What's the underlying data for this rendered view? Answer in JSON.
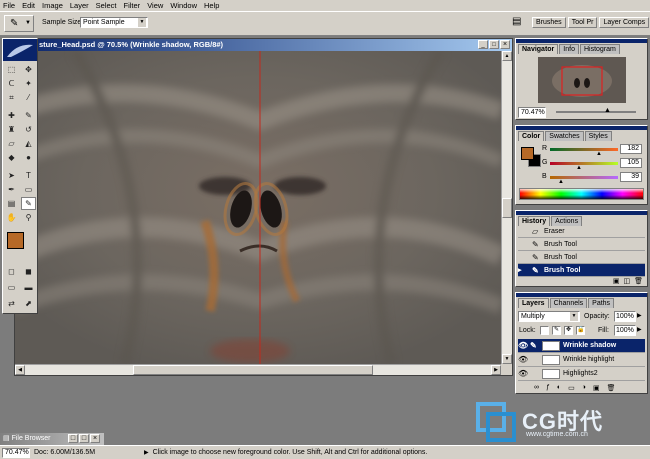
{
  "menu": [
    "File",
    "Edit",
    "Image",
    "Layer",
    "Select",
    "Filter",
    "View",
    "Window",
    "Help"
  ],
  "options": {
    "sample_size_label": "Sample Size:",
    "sample_size_value": "Point Sample"
  },
  "wells": [
    "Brushes",
    "Tool Pr",
    "Layer Comps"
  ],
  "document": {
    "title": "sture_Head.psd @ 70.5% (Wrinkle shadow, RGB/8#)"
  },
  "navigator": {
    "tabs": [
      "Navigator",
      "Info",
      "Histogram"
    ],
    "zoom": "70.47%"
  },
  "color": {
    "tabs": [
      "Color",
      "Swatches",
      "Styles"
    ],
    "r_label": "R",
    "g_label": "G",
    "b_label": "B",
    "r": "182",
    "g": "105",
    "b": "39",
    "fg": "#b66927",
    "bg": "#000000"
  },
  "history": {
    "tabs": [
      "History",
      "Actions"
    ],
    "items": [
      "Eraser",
      "Brush Tool",
      "Brush Tool",
      "Brush Tool"
    ]
  },
  "layers": {
    "tabs": [
      "Layers",
      "Channels",
      "Paths"
    ],
    "blend": "Multiply",
    "opacity_label": "Opacity:",
    "opacity": "100%",
    "lock_label": "Lock:",
    "fill_label": "Fill:",
    "fill": "100%",
    "items": [
      "Wrinkle shadow",
      "Wrinkle highlight",
      "Highlights2"
    ]
  },
  "file_browser": "File Browser",
  "status": {
    "zoom": "70.47%",
    "doc": "Doc: 6.00M/136.5M",
    "hint": "Click image to choose new foreground color.  Use Shift, Alt and Ctrl for additional options."
  },
  "watermark": {
    "brand": "CG时代",
    "url": "www.cgtime.com.cn"
  },
  "colors": {
    "accent": "#0a246a",
    "chrome": "#d4d0c8"
  }
}
